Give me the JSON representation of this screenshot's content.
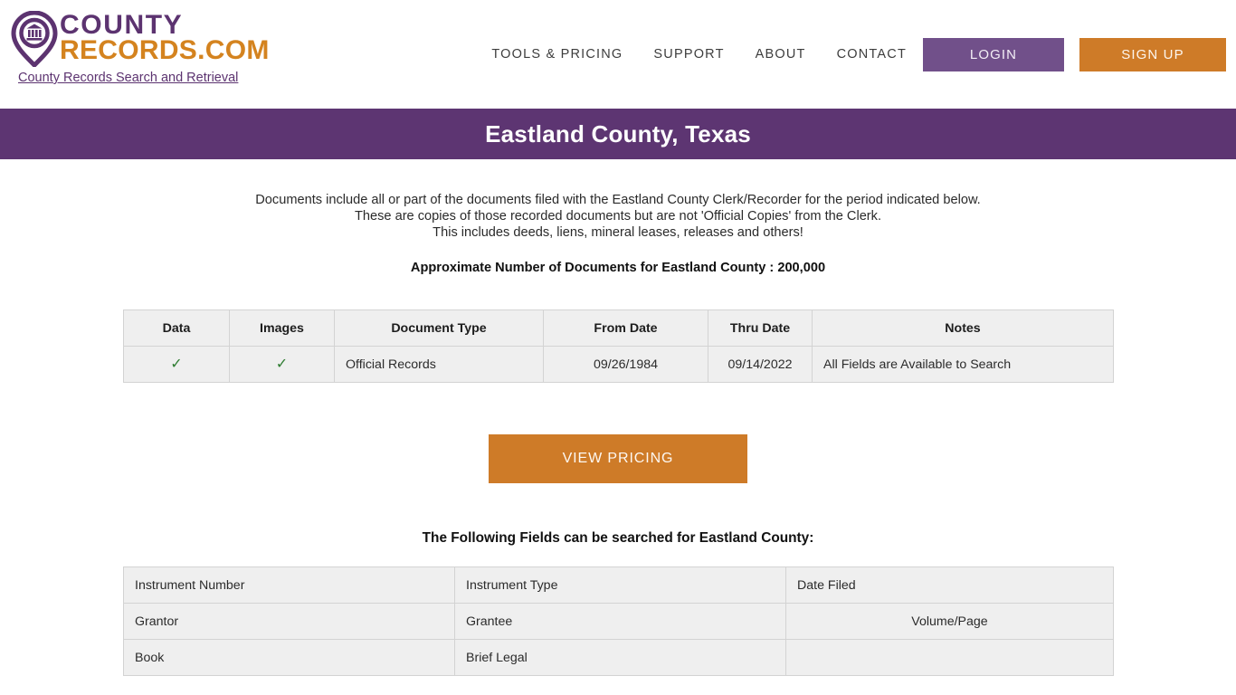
{
  "header": {
    "logo": {
      "icon": "courthouse-pin-icon",
      "line1": "COUNTY",
      "line2": "RECORDS.COM",
      "tagline": "County Records Search and Retrieval"
    },
    "nav_links": [
      {
        "label": "TOOLS & PRICING",
        "name": "tools-and-pricing"
      },
      {
        "label": "SUPPORT",
        "name": "support"
      },
      {
        "label": "ABOUT",
        "name": "about"
      },
      {
        "label": "CONTACT",
        "name": "contact"
      }
    ],
    "login_label": "LOGIN",
    "signup_label": "SIGN UP"
  },
  "banner": {
    "title": "Eastland County, Texas"
  },
  "intro": {
    "line1": "Documents include all or part of the documents filed with the Eastland County Clerk/Recorder for the period indicated below.",
    "line2": "These are copies of those recorded documents but are not 'Official Copies' from the Clerk.",
    "line3": "This includes deeds, liens, mineral leases, releases and others!",
    "doc_count": "Approximate Number of Documents for Eastland County : 200,000"
  },
  "records_table": {
    "headers": [
      "Data",
      "Images",
      "Document Type",
      "From Date",
      "Thru Date",
      "Notes"
    ],
    "rows": [
      {
        "data": "✓",
        "images": "✓",
        "document_type": "Official Records",
        "from_date": "09/26/1984",
        "thru_date": "09/14/2022",
        "notes": "All Fields are Available to Search"
      }
    ]
  },
  "pricing": {
    "button_label": "VIEW PRICING"
  },
  "fields_section": {
    "heading": "The Following Fields can be searched for Eastland County:",
    "rows": [
      [
        "Instrument Number",
        "Instrument Type",
        "Date Filed"
      ],
      [
        "Grantor",
        "Grantee",
        "Volume/Page"
      ],
      [
        "Book",
        "Brief Legal",
        ""
      ]
    ]
  },
  "colors": {
    "purple_banner": "#5d3572",
    "purple_login": "#71508a",
    "orange": "#ce7b28",
    "logo_purple": "#5c3370",
    "logo_orange": "#d4831f",
    "check_green": "#2f7d32"
  }
}
